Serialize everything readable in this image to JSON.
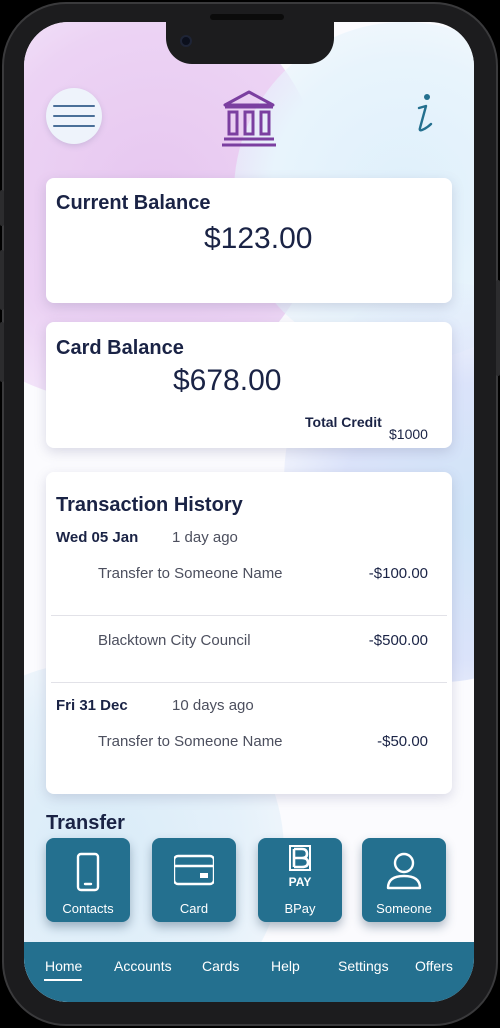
{
  "header": {
    "menu_icon": "hamburger-menu-icon",
    "logo_icon": "bank-building-icon",
    "info_icon": "info-icon"
  },
  "current_balance": {
    "title": "Current Balance",
    "amount": "$123.00"
  },
  "card_balance": {
    "title": "Card Balance",
    "amount": "$678.00",
    "total_credit_label": "Total Credit",
    "total_credit_value": "$1000"
  },
  "transactions": {
    "title": "Transaction History",
    "groups": [
      {
        "date": "Wed 05 Jan",
        "ago": "1 day ago",
        "items": [
          {
            "desc": "Transfer to Someone Name",
            "amount": "-$100.00"
          },
          {
            "desc": "Blacktown City Council",
            "amount": "-$500.00"
          }
        ]
      },
      {
        "date": "Fri 31 Dec",
        "ago": "10 days ago",
        "items": [
          {
            "desc": "Transfer to Someone Name",
            "amount": "-$50.00"
          }
        ]
      }
    ]
  },
  "transfer": {
    "title": "Transfer",
    "buttons": [
      {
        "label": "Contacts",
        "icon": "phone-icon"
      },
      {
        "label": "Card",
        "icon": "credit-card-icon"
      },
      {
        "label": "BPay",
        "icon": "bpay-icon",
        "icon_text": "PAY"
      },
      {
        "label": "Someone",
        "icon": "person-icon"
      }
    ]
  },
  "nav": {
    "items": [
      "Home",
      "Accounts",
      "Cards",
      "Help",
      "Settings",
      "Offers"
    ],
    "active": "Home"
  },
  "colors": {
    "accent": "#24708f",
    "text_dark": "#1a2345",
    "logo_purple": "#7b3fa0"
  }
}
